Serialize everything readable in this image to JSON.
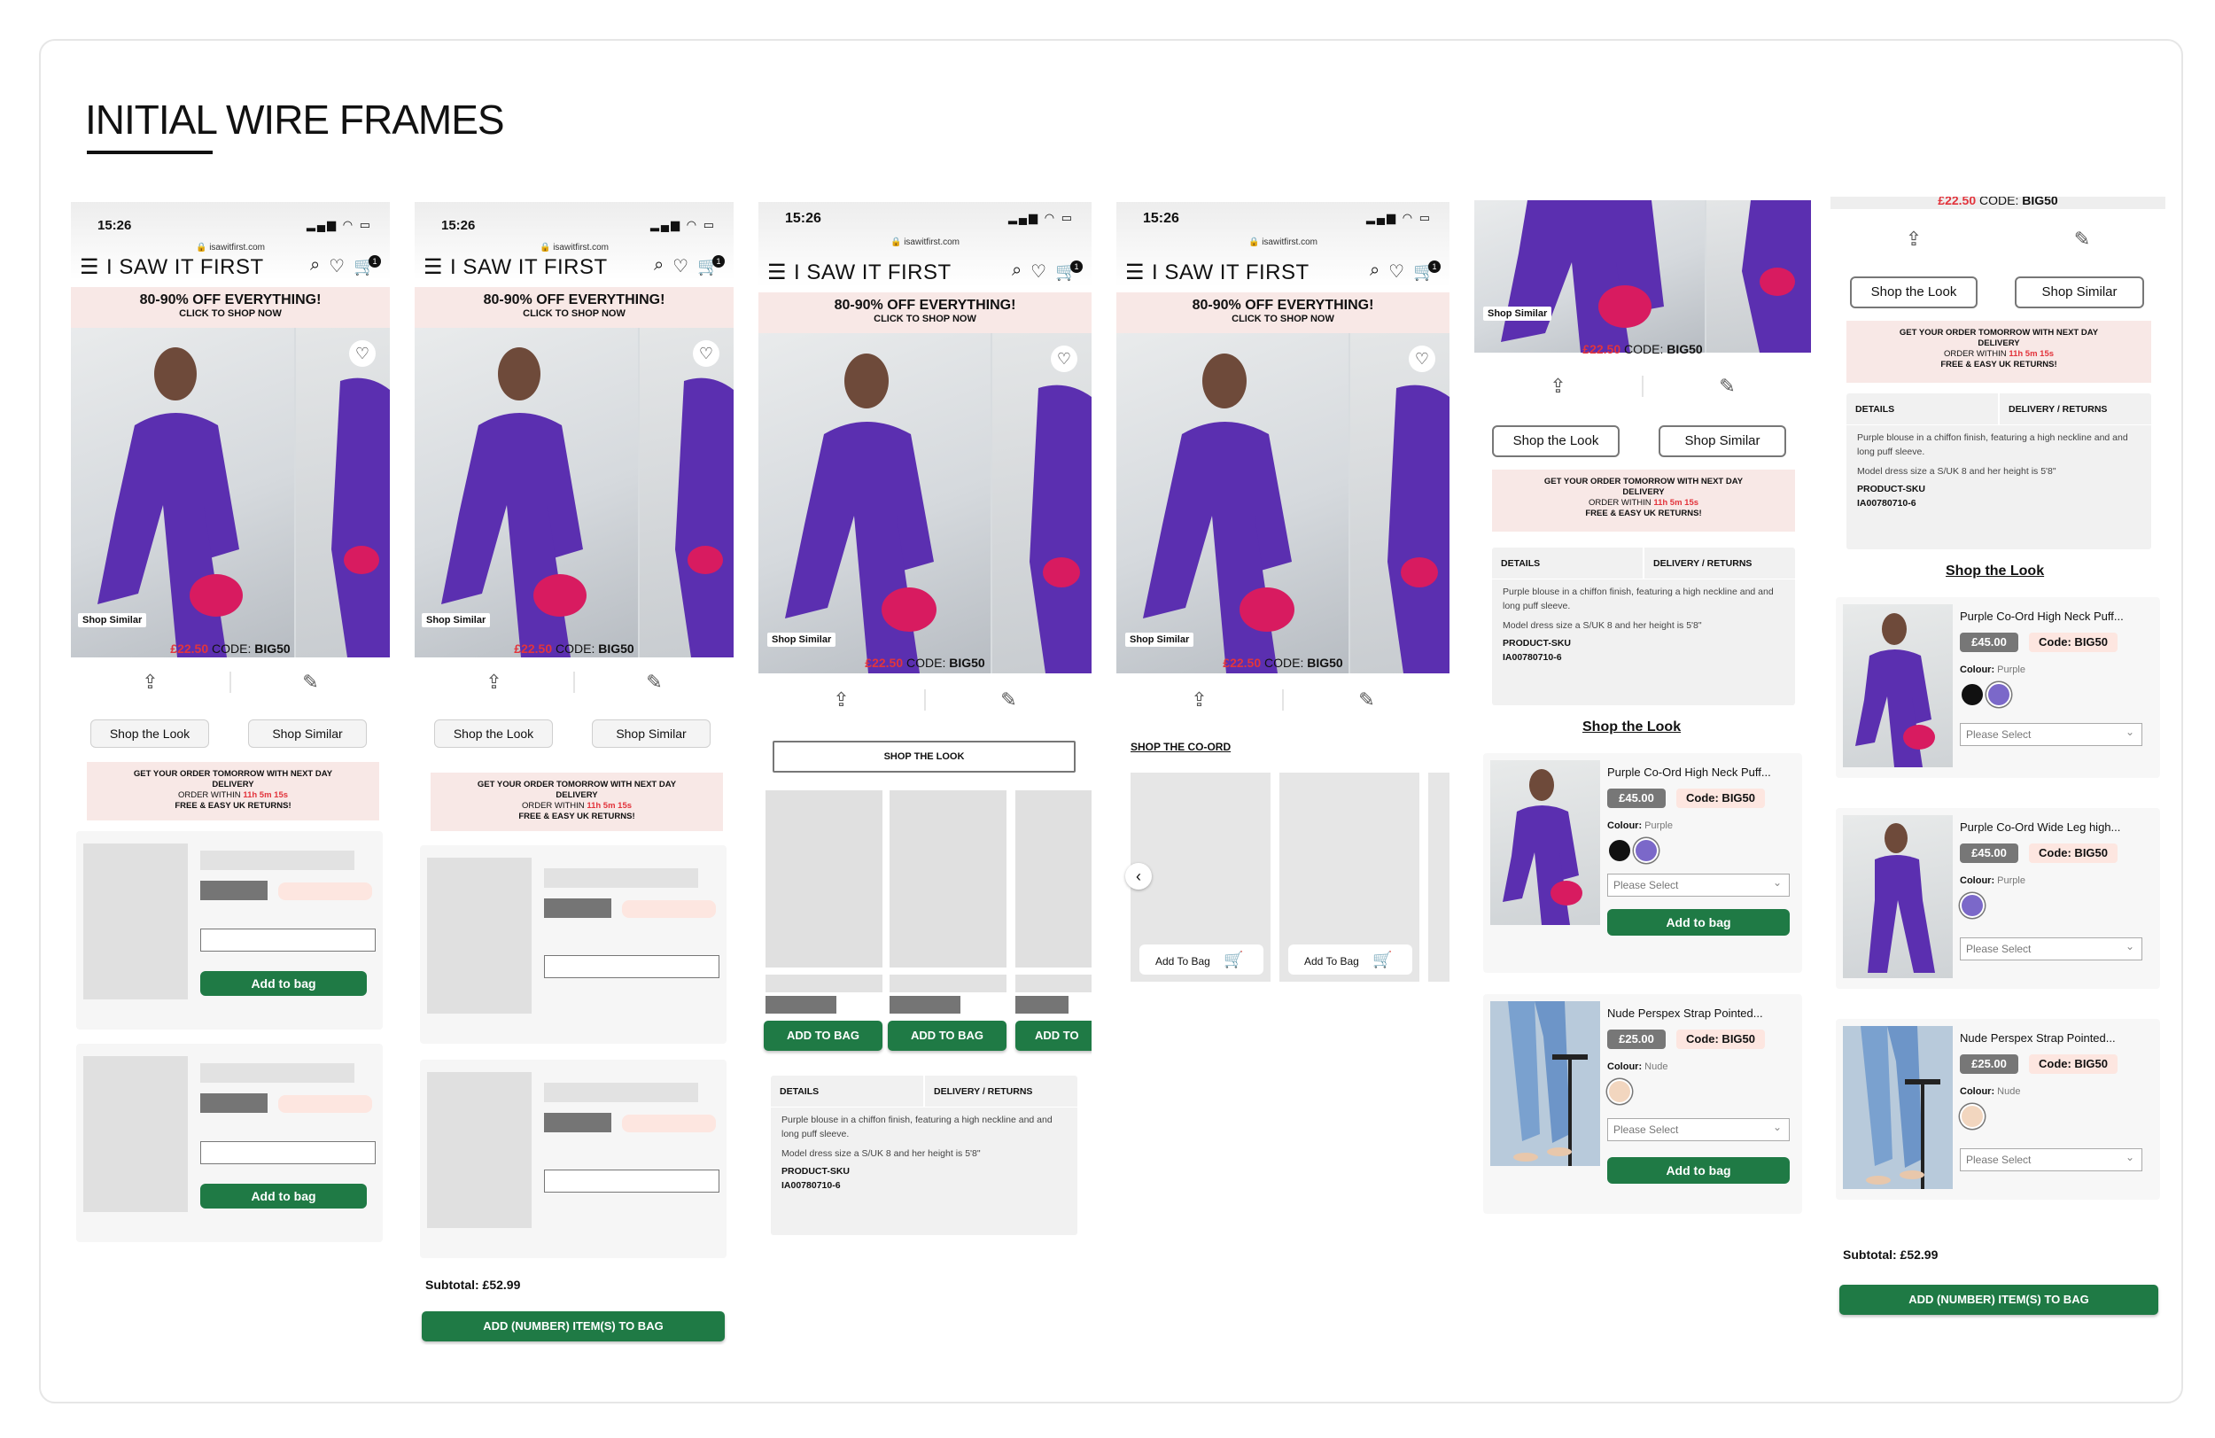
{
  "heading": "INITIAL WIRE FRAMES",
  "phone": {
    "time": "15:26",
    "status_icons": "▂▄▆ ◠ ▭",
    "url": "🔒 isawitfirst.com",
    "brand": "I SAW IT FIRST",
    "menu_icon": "☰",
    "search_icon": "⌕",
    "heart_icon": "♡",
    "cart_icon": "🛒",
    "cart_count": "1",
    "promo_line1": "80-90% OFF EVERYTHING!",
    "promo_line2": "CLICK TO SHOP NOW",
    "shop_similar_tag": "Shop Similar",
    "price": "£22.50",
    "code_label": "CODE:",
    "code": "BIG50",
    "share_icon": "⇪",
    "ruler_icon": "✎"
  },
  "buttons": {
    "shop_the_look": "Shop the Look",
    "shop_similar": "Shop Similar",
    "add_to_bag": "Add to bag",
    "add_to_bag_caps": "ADD TO BAG",
    "add_to_bag_cut": "ADD TO",
    "shop_the_look_caps": "SHOP THE LOOK",
    "add_items": "ADD (NUMBER) ITEM(S) TO BAG",
    "add_to_bag_title": "Add To Bag"
  },
  "delivery": {
    "line1": "GET YOUR ORDER TOMORROW WITH NEXT DAY",
    "line2": "DELIVERY",
    "line3a": "ORDER WITHIN",
    "line3b": "11h 5m 15s",
    "line4": "FREE & EASY UK RETURNS!"
  },
  "details": {
    "tab1": "DETAILS",
    "tab2": "DELIVERY / RETURNS",
    "text1": "Purple blouse in a chiffon finish, featuring a high neckline and and long puff sleeve.",
    "text2": "Model dress size a S/UK 8 and her height is 5'8\"",
    "sku_label": "PRODUCT-SKU",
    "sku": "IA00780710-6"
  },
  "subtotal": "Subtotal:  £52.99",
  "shop_co_ord": "SHOP THE CO-ORD",
  "shop_the_look_heading": "Shop the Look",
  "products": [
    {
      "title": "Purple Co-Ord High Neck Puff...",
      "price": "£45.00",
      "code": "Code: BIG50",
      "colour_label": "Colour:",
      "colour": "Purple",
      "select": "Please Select"
    },
    {
      "title": "Purple Co-Ord Wide Leg high...",
      "price": "£45.00",
      "code": "Code: BIG50",
      "colour_label": "Colour:",
      "colour": "Purple",
      "select": "Please Select"
    },
    {
      "title": "Nude Perspex Strap Pointed...",
      "price": "£25.00",
      "code": "Code: BIG50",
      "colour_label": "Colour:",
      "colour": "Nude",
      "select": "Please Select"
    }
  ],
  "colors": {
    "brand_green": "#1f7a45",
    "promo_pink": "#f8e8e6",
    "price_red": "#e2343c",
    "purple": "#5b2fb0"
  }
}
